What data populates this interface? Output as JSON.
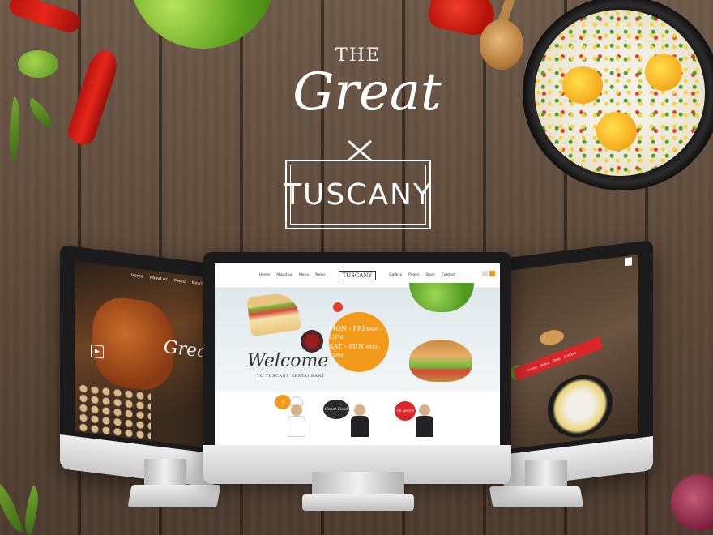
{
  "brand": {
    "line_1": "THE",
    "line_2": "Great",
    "line_3": "TUSCANY"
  },
  "center_site": {
    "nav_left": [
      "Home",
      "About us",
      "Menu",
      "News"
    ],
    "logo": "TUSCANY",
    "nav_right": [
      "Gallery",
      "Pages",
      "Shop",
      "Contact"
    ],
    "hours": [
      {
        "days": "MON - FRI",
        "time": "8AM - 12PM"
      },
      {
        "days": "SAT - SUN",
        "time": "8AM - 12PM"
      }
    ],
    "welcome": "Welcome",
    "welcome_sub": "TO TUSCANY RESTAURANT",
    "bubbles": [
      "-5",
      "Great Food",
      "16 years"
    ]
  },
  "left_site": {
    "nav": [
      "Home",
      "About us",
      "Menu",
      "News"
    ],
    "logo": "Great"
  },
  "right_site": {
    "ribbon": [
      "Home",
      "About",
      "Shop",
      "Contact"
    ]
  },
  "colors": {
    "accent_orange": "#f39a1b",
    "accent_red": "#d8262b",
    "wood_dark": "#4e3c2f"
  }
}
